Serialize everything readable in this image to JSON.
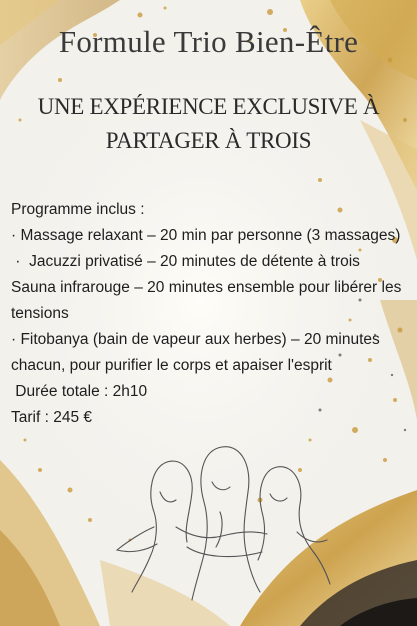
{
  "title": "Formule Trio Bien-Être",
  "subtitle_lines": [
    "UNE EXPÉRIENCE EXCLUSIVE À",
    "PARTAGER À TROIS"
  ],
  "program": {
    "heading": "Programme inclus :",
    "items": [
      "· Massage relaxant – 20 min par personne (3 massages)",
      " ·  Jacuzzi privatisé – 20 minutes de détente à trois",
      "Sauna infrarouge – 20 minutes ensemble pour libérer les tensions",
      "·  Fitobanya (bain de vapeur aux herbes) – 20 minutes chacun, pour purifier le corps et apaiser l'esprit"
    ],
    "duration": " Durée totale : 2h10",
    "price": "Tarif : 245 €"
  },
  "colors": {
    "gold": "#c9a04c",
    "dark_brush": "#2a2420",
    "text": "#1e1e1e"
  },
  "illustration_icon": "three-women-line-art-icon"
}
